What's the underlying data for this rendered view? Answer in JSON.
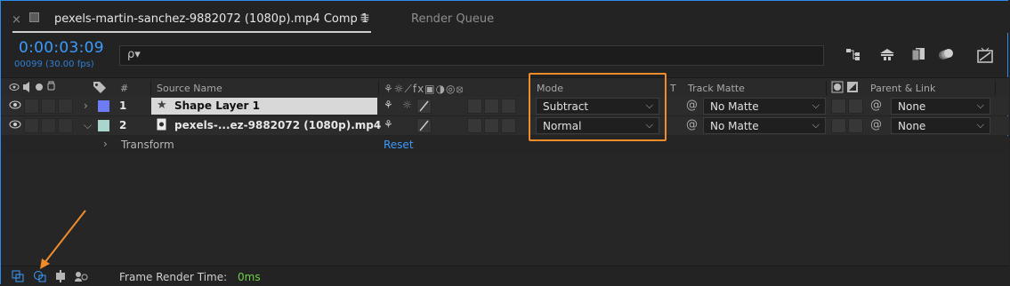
{
  "tabs": {
    "close": "×",
    "comp_title": "pexels-martin-sanchez-9882072 (1080p).mp4 Comp 1",
    "menu": "≡",
    "render_queue": "Render Queue"
  },
  "timecode": {
    "time": "0:00:03:09",
    "frames_fps": "00099 (30.00 fps)"
  },
  "search": {
    "placeholder": "",
    "icon": "ρ▾"
  },
  "toolbar_icons": [
    "comp-flowchart-icon",
    "draft-3d-icon",
    "frame-blending-icon",
    "motion-blur-icon",
    "graph-editor-icon"
  ],
  "headers": {
    "num": "#",
    "source_name": "Source Name",
    "switches": "⚘☼⟋fx▣◑◎⦻",
    "mode": "Mode",
    "t": "T",
    "track_matte": "Track Matte",
    "parent_link": "Parent & Link"
  },
  "layers": [
    {
      "num": "1",
      "name": "Shape Layer 1",
      "label_color": "#6d7bf5",
      "mode": "Subtract",
      "track_matte": "No Matte",
      "parent": "None"
    },
    {
      "num": "2",
      "name": "pexels-...ez-9882072 (1080p).mp4",
      "label_color": "#a8d6ce",
      "mode": "Normal",
      "track_matte": "No Matte",
      "parent": "None"
    }
  ],
  "transform": {
    "label": "Transform",
    "reset": "Reset"
  },
  "bottom": {
    "frame_render_label": "Frame Render Time:",
    "frame_render_value": "0ms"
  },
  "colors": {
    "accent_blue": "#3a9bff",
    "highlight_orange": "#ee8d2a",
    "render_time_green": "#6ecf4a"
  }
}
